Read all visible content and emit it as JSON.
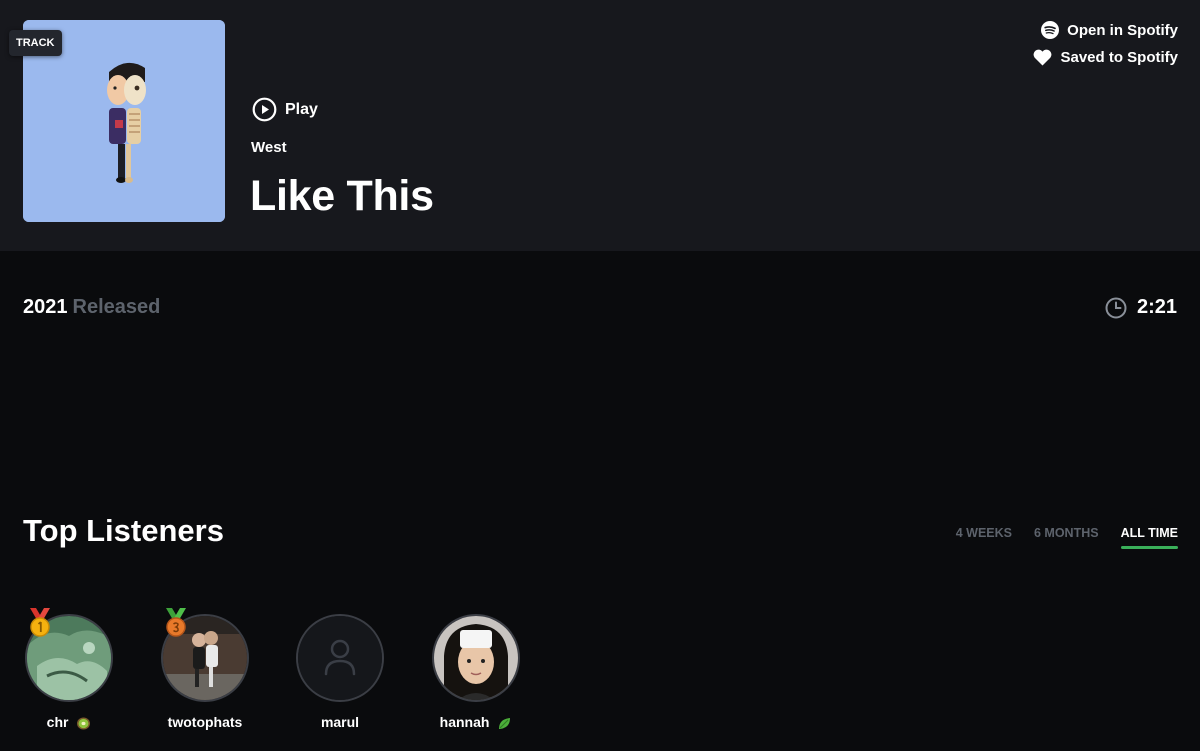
{
  "track": {
    "type_badge": "TRACK",
    "play_label": "Play",
    "artist": "West",
    "title": "Like This",
    "released_year": "2021",
    "released_label": "Released",
    "duration": "2:21"
  },
  "actions": {
    "open_spotify": "Open in Spotify",
    "saved_spotify": "Saved to Spotify"
  },
  "top_listeners": {
    "title": "Top Listeners",
    "tabs": [
      {
        "label": "4 WEEKS",
        "active": false
      },
      {
        "label": "6 MONTHS",
        "active": false
      },
      {
        "label": "ALL TIME",
        "active": true
      }
    ],
    "listeners": [
      {
        "name": "chr",
        "emoji": "kiwi-icon",
        "medal": "gold"
      },
      {
        "name": "twotophats",
        "emoji": "",
        "medal": "bronze"
      },
      {
        "name": "marul",
        "emoji": "",
        "medal": ""
      },
      {
        "name": "hannah",
        "emoji": "leaf-icon",
        "medal": ""
      }
    ]
  },
  "colors": {
    "header_bg": "#17181d",
    "page_bg": "#0a0b0d",
    "muted_text": "#5d636c",
    "accent_green": "#3ab05a",
    "cover_bg": "#9bb9ee"
  }
}
